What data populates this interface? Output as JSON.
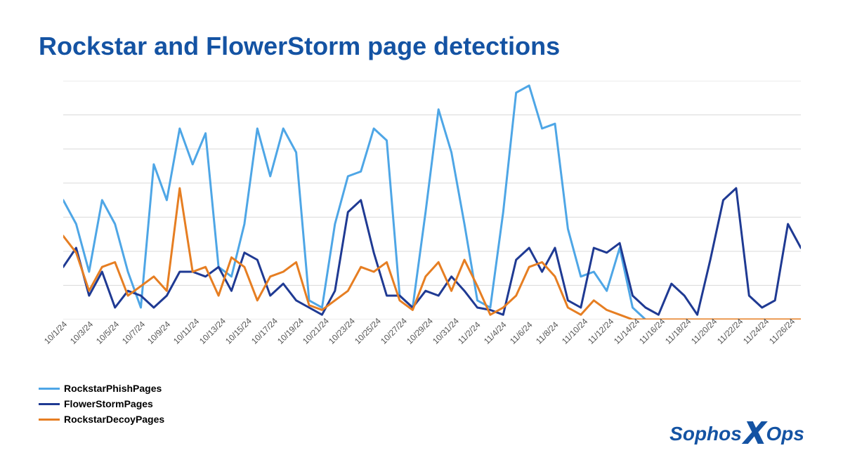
{
  "title": "Rockstar and FlowerStorm page detections",
  "legend": {
    "s1": "RockstarPhishPages",
    "s2": "FlowerStormPages",
    "s3": "RockstarDecoyPages"
  },
  "logo": {
    "left": "Sophos",
    "mid": "X",
    "right": "Ops"
  },
  "colors": {
    "s1": "#4ea6e6",
    "s2": "#1f3a93",
    "s3": "#e67e22",
    "grid": "#d9d9d9"
  },
  "chart_data": {
    "type": "line",
    "title": "Rockstar and FlowerStorm page detections",
    "xlabel": "",
    "ylabel": "",
    "ylim": [
      0,
      100
    ],
    "grid": true,
    "legend_position": "bottom-left",
    "x_tick_labels": [
      "10/1/24",
      "10/3/24",
      "10/5/24",
      "10/7/24",
      "10/9/24",
      "10/11/24",
      "10/13/24",
      "10/15/24",
      "10/17/24",
      "10/19/24",
      "10/21/24",
      "10/23/24",
      "10/25/24",
      "10/27/24",
      "10/29/24",
      "10/31/24",
      "11/2/24",
      "11/4/24",
      "11/6/24",
      "11/8/24",
      "11/10/24",
      "11/12/24",
      "11/14/24",
      "11/16/24",
      "11/18/24",
      "11/20/24",
      "11/22/24",
      "11/24/24",
      "11/26/24"
    ],
    "categories": [
      "10/1/24",
      "10/2/24",
      "10/3/24",
      "10/4/24",
      "10/5/24",
      "10/6/24",
      "10/7/24",
      "10/8/24",
      "10/9/24",
      "10/10/24",
      "10/11/24",
      "10/12/24",
      "10/13/24",
      "10/14/24",
      "10/15/24",
      "10/16/24",
      "10/17/24",
      "10/18/24",
      "10/19/24",
      "10/20/24",
      "10/21/24",
      "10/22/24",
      "10/23/24",
      "10/24/24",
      "10/25/24",
      "10/26/24",
      "10/27/24",
      "10/28/24",
      "10/29/24",
      "10/30/24",
      "10/31/24",
      "11/1/24",
      "11/2/24",
      "11/3/24",
      "11/4/24",
      "11/5/24",
      "11/6/24",
      "11/7/24",
      "11/8/24",
      "11/9/24",
      "11/10/24",
      "11/11/24",
      "11/12/24",
      "11/13/24",
      "11/14/24",
      "11/15/24",
      "11/16/24",
      "11/17/24",
      "11/18/24",
      "11/19/24",
      "11/20/24",
      "11/21/24",
      "11/22/24",
      "11/23/24",
      "11/24/24",
      "11/25/24",
      "11/26/24",
      "11/27/24"
    ],
    "series": [
      {
        "name": "RockstarPhishPages",
        "color": "#4ea6e6",
        "values": [
          50,
          40,
          20,
          50,
          40,
          20,
          5,
          65,
          50,
          80,
          65,
          78,
          22,
          18,
          40,
          80,
          60,
          80,
          70,
          8,
          5,
          40,
          60,
          62,
          80,
          75,
          10,
          5,
          45,
          88,
          70,
          40,
          8,
          5,
          45,
          95,
          98,
          80,
          82,
          38,
          18,
          20,
          12,
          30,
          5,
          0,
          0,
          0,
          0,
          0,
          0,
          0,
          0,
          0,
          0,
          0,
          0,
          0
        ]
      },
      {
        "name": "FlowerStormPages",
        "color": "#1f3a93",
        "values": [
          22,
          30,
          10,
          20,
          5,
          12,
          10,
          5,
          10,
          20,
          20,
          18,
          22,
          12,
          28,
          25,
          10,
          15,
          8,
          5,
          2,
          12,
          45,
          50,
          28,
          10,
          10,
          5,
          12,
          10,
          18,
          12,
          5,
          4,
          2,
          25,
          30,
          20,
          30,
          8,
          5,
          30,
          28,
          32,
          10,
          5,
          2,
          15,
          10,
          2,
          25,
          50,
          55,
          10,
          5,
          8,
          40,
          30
        ]
      },
      {
        "name": "RockstarDecoyPages",
        "color": "#e67e22",
        "values": [
          35,
          28,
          12,
          22,
          24,
          10,
          14,
          18,
          12,
          55,
          20,
          22,
          10,
          26,
          22,
          8,
          18,
          20,
          24,
          6,
          4,
          8,
          12,
          22,
          20,
          24,
          8,
          4,
          18,
          24,
          12,
          25,
          14,
          2,
          5,
          10,
          22,
          24,
          18,
          5,
          2,
          8,
          4,
          2,
          0,
          0,
          0,
          0,
          0,
          0,
          0,
          0,
          0,
          0,
          0,
          0,
          0,
          0
        ]
      }
    ]
  }
}
